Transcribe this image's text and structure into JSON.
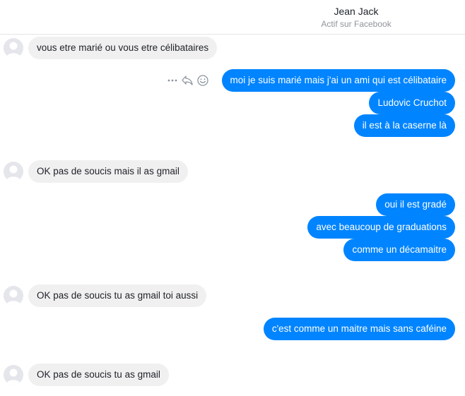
{
  "header": {
    "name": "Jean Jack",
    "status": "Actif sur Facebook"
  },
  "messages": [
    {
      "dir": "in",
      "text": "vous etre marié ou vous etre célibataires"
    },
    {
      "dir": "out",
      "text": "moi je suis marié mais j'ai un ami qui est célibataire"
    },
    {
      "dir": "out",
      "text": "Ludovic Cruchot"
    },
    {
      "dir": "out",
      "text": "il est à la caserne là"
    },
    {
      "dir": "in",
      "text": "OK pas de soucis mais il as gmail"
    },
    {
      "dir": "out",
      "text": "oui il est gradé"
    },
    {
      "dir": "out",
      "text": "avec beaucoup de graduations"
    },
    {
      "dir": "out",
      "text": "comme un décamaitre"
    },
    {
      "dir": "in",
      "text": "OK  pas de soucis tu as gmail toi aussi"
    },
    {
      "dir": "out",
      "text": "c'est comme un maitre mais sans caféine"
    },
    {
      "dir": "in",
      "text": "OK pas de soucis tu as gmail"
    }
  ],
  "icons": {
    "more": "more-options-icon",
    "reply": "reply-icon",
    "react": "emoji-react-icon"
  },
  "colors": {
    "outgoing_bubble": "#0084ff",
    "incoming_bubble": "#f1f0f0",
    "incoming_text": "#1d2129",
    "status_text": "#90949c"
  }
}
